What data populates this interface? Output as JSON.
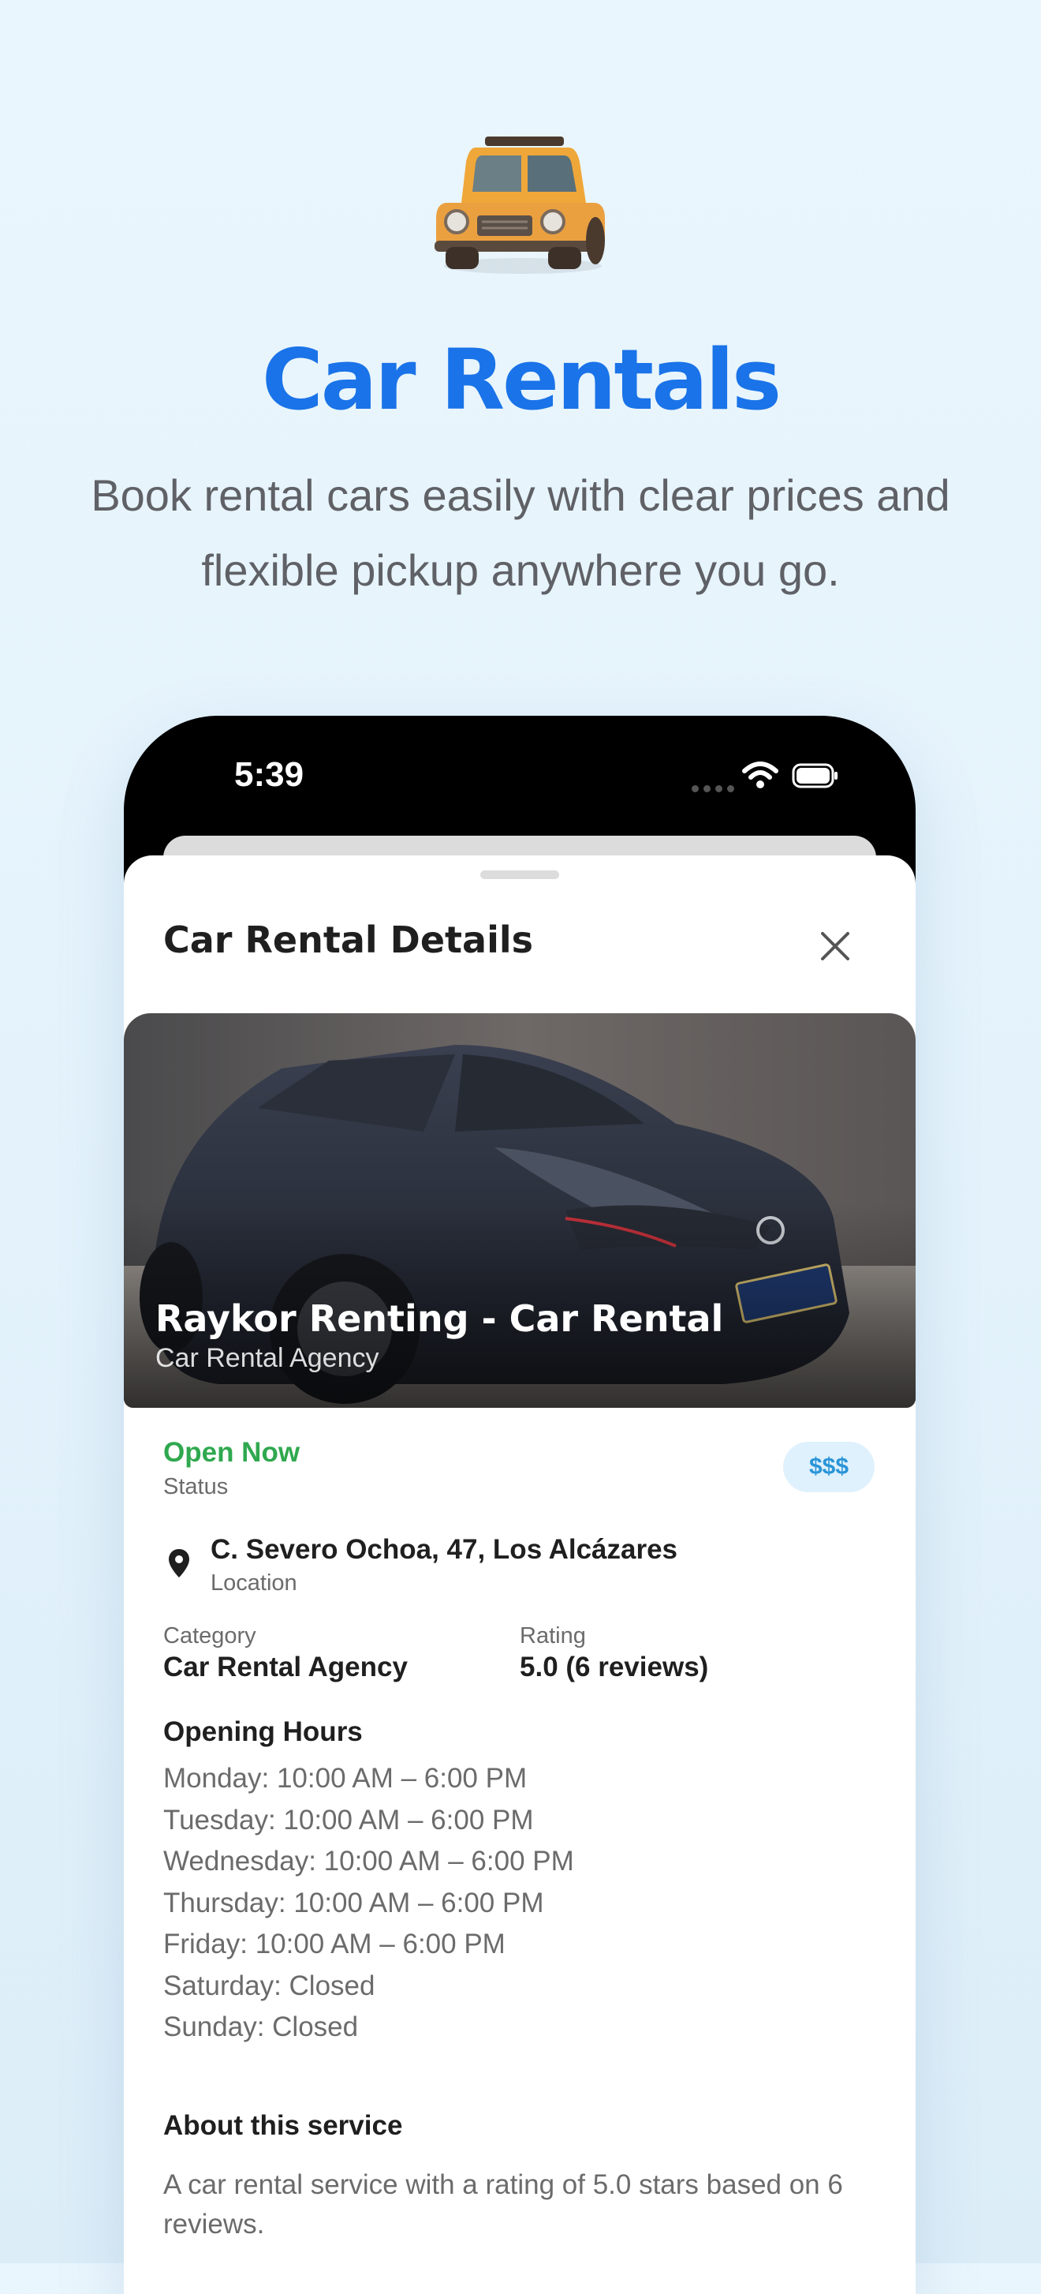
{
  "hero": {
    "title": "Car Rentals",
    "subtitle": "Book rental cars easily with clear prices and flexible pickup anywhere you go.",
    "icon": "car-emoji-icon"
  },
  "status_bar": {
    "time": "5:39",
    "icons": [
      "signal-dots-icon",
      "wifi-icon",
      "battery-icon"
    ]
  },
  "sheet": {
    "title": "Car Rental Details",
    "close_icon": "close-icon"
  },
  "listing": {
    "name": "Raykor Renting - Car Rental",
    "type": "Car Rental Agency",
    "status_value": "Open Now",
    "status_label": "Status",
    "price_level": "$$$",
    "location_value": "C. Severo Ochoa, 47, Los Alcázares",
    "location_label": "Location",
    "category_label": "Category",
    "category_value": "Car Rental Agency",
    "rating_label": "Rating",
    "rating_value": "5.0 (6 reviews)",
    "hours_heading": "Opening Hours",
    "hours": [
      "Monday: 10:00 AM – 6:00 PM",
      "Tuesday: 10:00 AM – 6:00 PM",
      "Wednesday: 10:00 AM – 6:00 PM",
      "Thursday: 10:00 AM – 6:00 PM",
      "Friday: 10:00 AM – 6:00 PM",
      "Saturday: Closed",
      "Sunday: Closed"
    ],
    "about_heading": "About this service",
    "about_text": "A car rental service with a rating of 5.0 stars based on 6 reviews."
  },
  "colors": {
    "accent": "#1a73e8",
    "open_status": "#2fa84f",
    "price_badge_bg": "#dff1fc",
    "price_badge_text": "#2a95d8"
  }
}
